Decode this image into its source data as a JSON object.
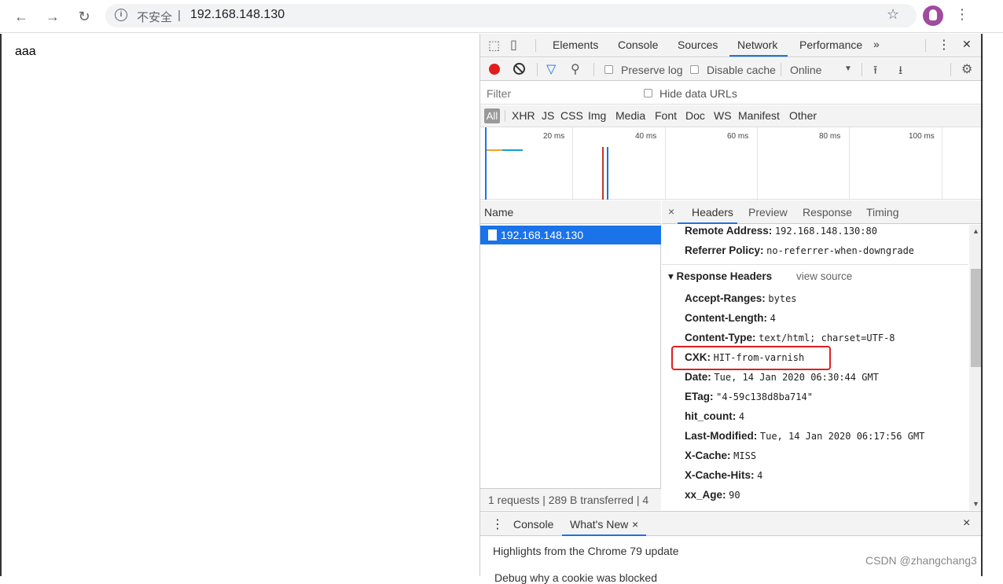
{
  "browser": {
    "back_icon": "arrow-left-icon",
    "forward_icon": "arrow-right-icon",
    "reload_icon": "reload-icon",
    "security_label": "不安全",
    "separator": "|",
    "url": "192.168.148.130",
    "star_icon": "star-icon",
    "menu_icon": "more-vertical-icon"
  },
  "page": {
    "content_text": "aaa"
  },
  "devtools": {
    "tabs": [
      "Elements",
      "Console",
      "Sources",
      "Network",
      "Performance"
    ],
    "active_tab": "Network",
    "more_tabs": "»",
    "menu": "⋮",
    "close": "✕",
    "controls": {
      "preserve_log": "Preserve log",
      "disable_cache": "Disable cache",
      "throttling": "Online",
      "throttling_arrow": "▼"
    },
    "filter": {
      "placeholder": "Filter",
      "hide_data_urls": "Hide data URLs"
    },
    "types": [
      "All",
      "XHR",
      "JS",
      "CSS",
      "Img",
      "Media",
      "Font",
      "Doc",
      "WS",
      "Manifest",
      "Other"
    ],
    "overview_ticks": [
      "20 ms",
      "40 ms",
      "60 ms",
      "80 ms",
      "100 ms"
    ],
    "name_header": "Name",
    "request_name": "192.168.148.130",
    "status": "1 requests | 289 B transferred | 4",
    "detail_tabs": {
      "close": "×",
      "headers": "Headers",
      "preview": "Preview",
      "response": "Response",
      "timing": "Timing"
    },
    "general": [
      {
        "key": "Remote Address:",
        "value": "192.168.148.130:80"
      },
      {
        "key": "Referrer Policy:",
        "value": "no-referrer-when-downgrade"
      }
    ],
    "response_headers_title": "▾ Response Headers",
    "view_source": "view source",
    "response_headers": [
      {
        "key": "Accept-Ranges:",
        "value": "bytes"
      },
      {
        "key": "Content-Length:",
        "value": "4"
      },
      {
        "key": "Content-Type:",
        "value": "text/html; charset=UTF-8"
      },
      {
        "key": "CXK:",
        "value": "HIT-from-varnish"
      },
      {
        "key": "Date:",
        "value": "Tue, 14 Jan 2020 06:30:44 GMT"
      },
      {
        "key": "ETag:",
        "value": "\"4-59c138d8ba714\""
      },
      {
        "key": "hit_count:",
        "value": "4"
      },
      {
        "key": "Last-Modified:",
        "value": "Tue, 14 Jan 2020 06:17:56 GMT"
      },
      {
        "key": "X-Cache:",
        "value": "MISS"
      },
      {
        "key": "X-Cache-Hits:",
        "value": "4"
      },
      {
        "key": "xx_Age:",
        "value": "90"
      }
    ],
    "drawer": {
      "menu": "⋮",
      "console": "Console",
      "whats_new": "What's New",
      "whats_new_close": "×",
      "close": "×",
      "highlights": "Highlights from the Chrome 79 update",
      "cut_text": "Debug why a cookie was blocked"
    }
  },
  "watermark": "CSDN @zhangchang3"
}
